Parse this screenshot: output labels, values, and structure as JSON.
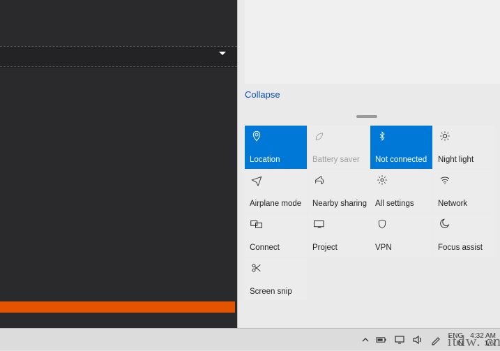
{
  "actionCenter": {
    "collapse": "Collapse",
    "tiles": [
      {
        "label": "Location",
        "state": "active"
      },
      {
        "label": "Battery saver",
        "state": "disabled"
      },
      {
        "label": "Not connected",
        "state": "active"
      },
      {
        "label": "Night light",
        "state": "normal"
      },
      {
        "label": "Airplane mode",
        "state": "normal"
      },
      {
        "label": "Nearby sharing",
        "state": "normal"
      },
      {
        "label": "All settings",
        "state": "normal"
      },
      {
        "label": "Network",
        "state": "normal"
      },
      {
        "label": "Connect",
        "state": "normal"
      },
      {
        "label": "Project",
        "state": "normal"
      },
      {
        "label": "VPN",
        "state": "normal"
      },
      {
        "label": "Focus assist",
        "state": "normal"
      },
      {
        "label": "Screen snip",
        "state": "normal"
      }
    ]
  },
  "taskbar": {
    "lang1": "ENG",
    "lang2": "IN",
    "time": "4:32 AM",
    "date": "1/6/"
  },
  "watermark": "itdw. cn"
}
